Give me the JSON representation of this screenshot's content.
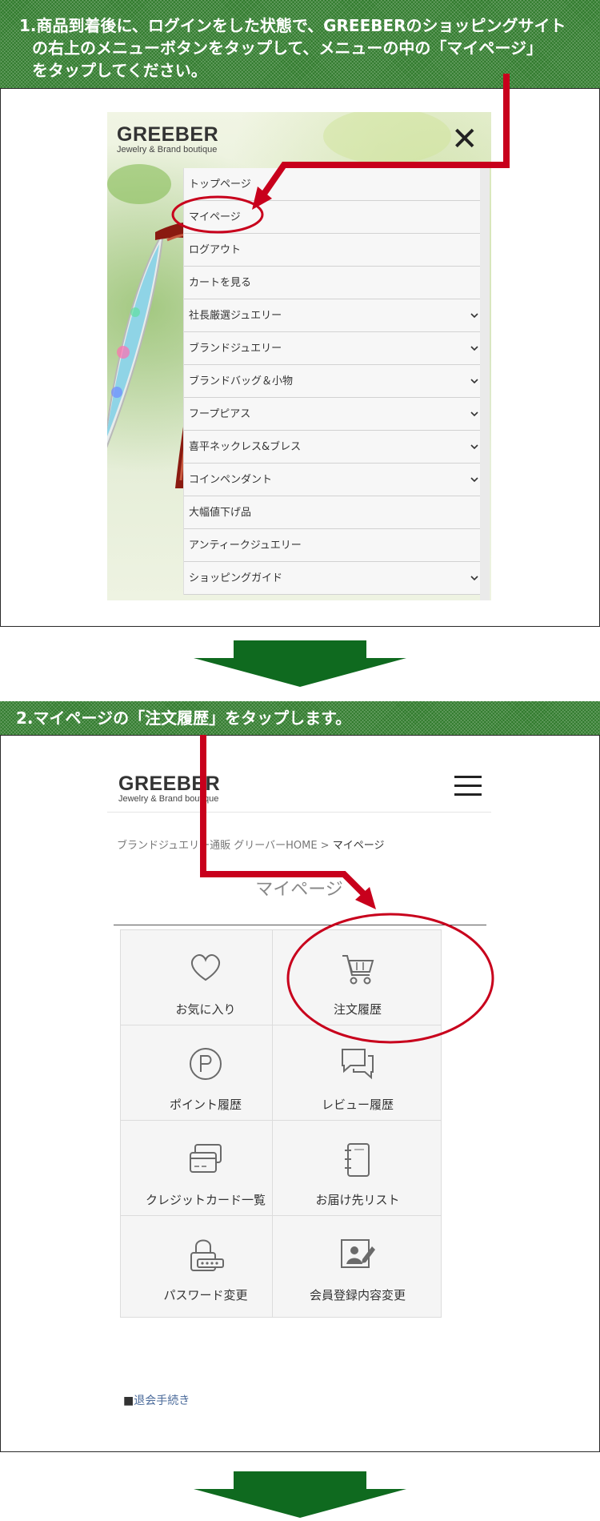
{
  "step1": {
    "line1": "1.商品到着後に、ログインをした状態で、GREEBERのショッピングサイト",
    "line2": "の右上のメニューボタンをタップして、メニューの中の「マイページ」",
    "line3": "をタップしてください。"
  },
  "step2": {
    "text": "2.マイページの「注文履歴」をタップします。"
  },
  "brand": {
    "name": "GREEBER",
    "tagline": "Jewelry & Brand boutique"
  },
  "menu": {
    "close_glyph": "✕",
    "items": [
      {
        "label": "トップページ",
        "expandable": false
      },
      {
        "label": "マイページ",
        "expandable": false
      },
      {
        "label": "ログアウト",
        "expandable": false
      },
      {
        "label": "カートを見る",
        "expandable": false
      },
      {
        "label": "社長厳選ジュエリー",
        "expandable": true
      },
      {
        "label": "ブランドジュエリー",
        "expandable": true
      },
      {
        "label": "ブランドバッグ＆小物",
        "expandable": true
      },
      {
        "label": "フープピアス",
        "expandable": true
      },
      {
        "label": "喜平ネックレス&ブレス",
        "expandable": true
      },
      {
        "label": "コインペンダント",
        "expandable": true
      },
      {
        "label": "大幅値下げ品",
        "expandable": false
      },
      {
        "label": "アンティークジュエリー",
        "expandable": false
      },
      {
        "label": "ショッピングガイド",
        "expandable": true
      }
    ],
    "chevron_glyph": "⌄"
  },
  "mypage": {
    "breadcrumb": {
      "home": "ブランドジュエリー通販 グリーバーHOME",
      "separator": " > ",
      "current": "マイページ"
    },
    "title": "マイページ",
    "tiles": [
      {
        "label": "お気に入り",
        "icon": "heart-icon"
      },
      {
        "label": "注文履歴",
        "icon": "cart-icon"
      },
      {
        "label": "ポイント履歴",
        "icon": "point-icon"
      },
      {
        "label": "レビュー履歴",
        "icon": "chat-icon"
      },
      {
        "label": "クレジットカード一覧",
        "icon": "credit-card-icon"
      },
      {
        "label": "お届け先リスト",
        "icon": "address-book-icon"
      },
      {
        "label": "パスワード変更",
        "icon": "lock-icon"
      },
      {
        "label": "会員登録内容変更",
        "icon": "profile-edit-icon"
      }
    ],
    "withdraw_bullet": "■",
    "withdraw_label": "退会手続き"
  },
  "colors": {
    "header_green": "#2f7a2b",
    "arrow_green": "#0f6a1f",
    "highlight_red": "#c8001c"
  }
}
